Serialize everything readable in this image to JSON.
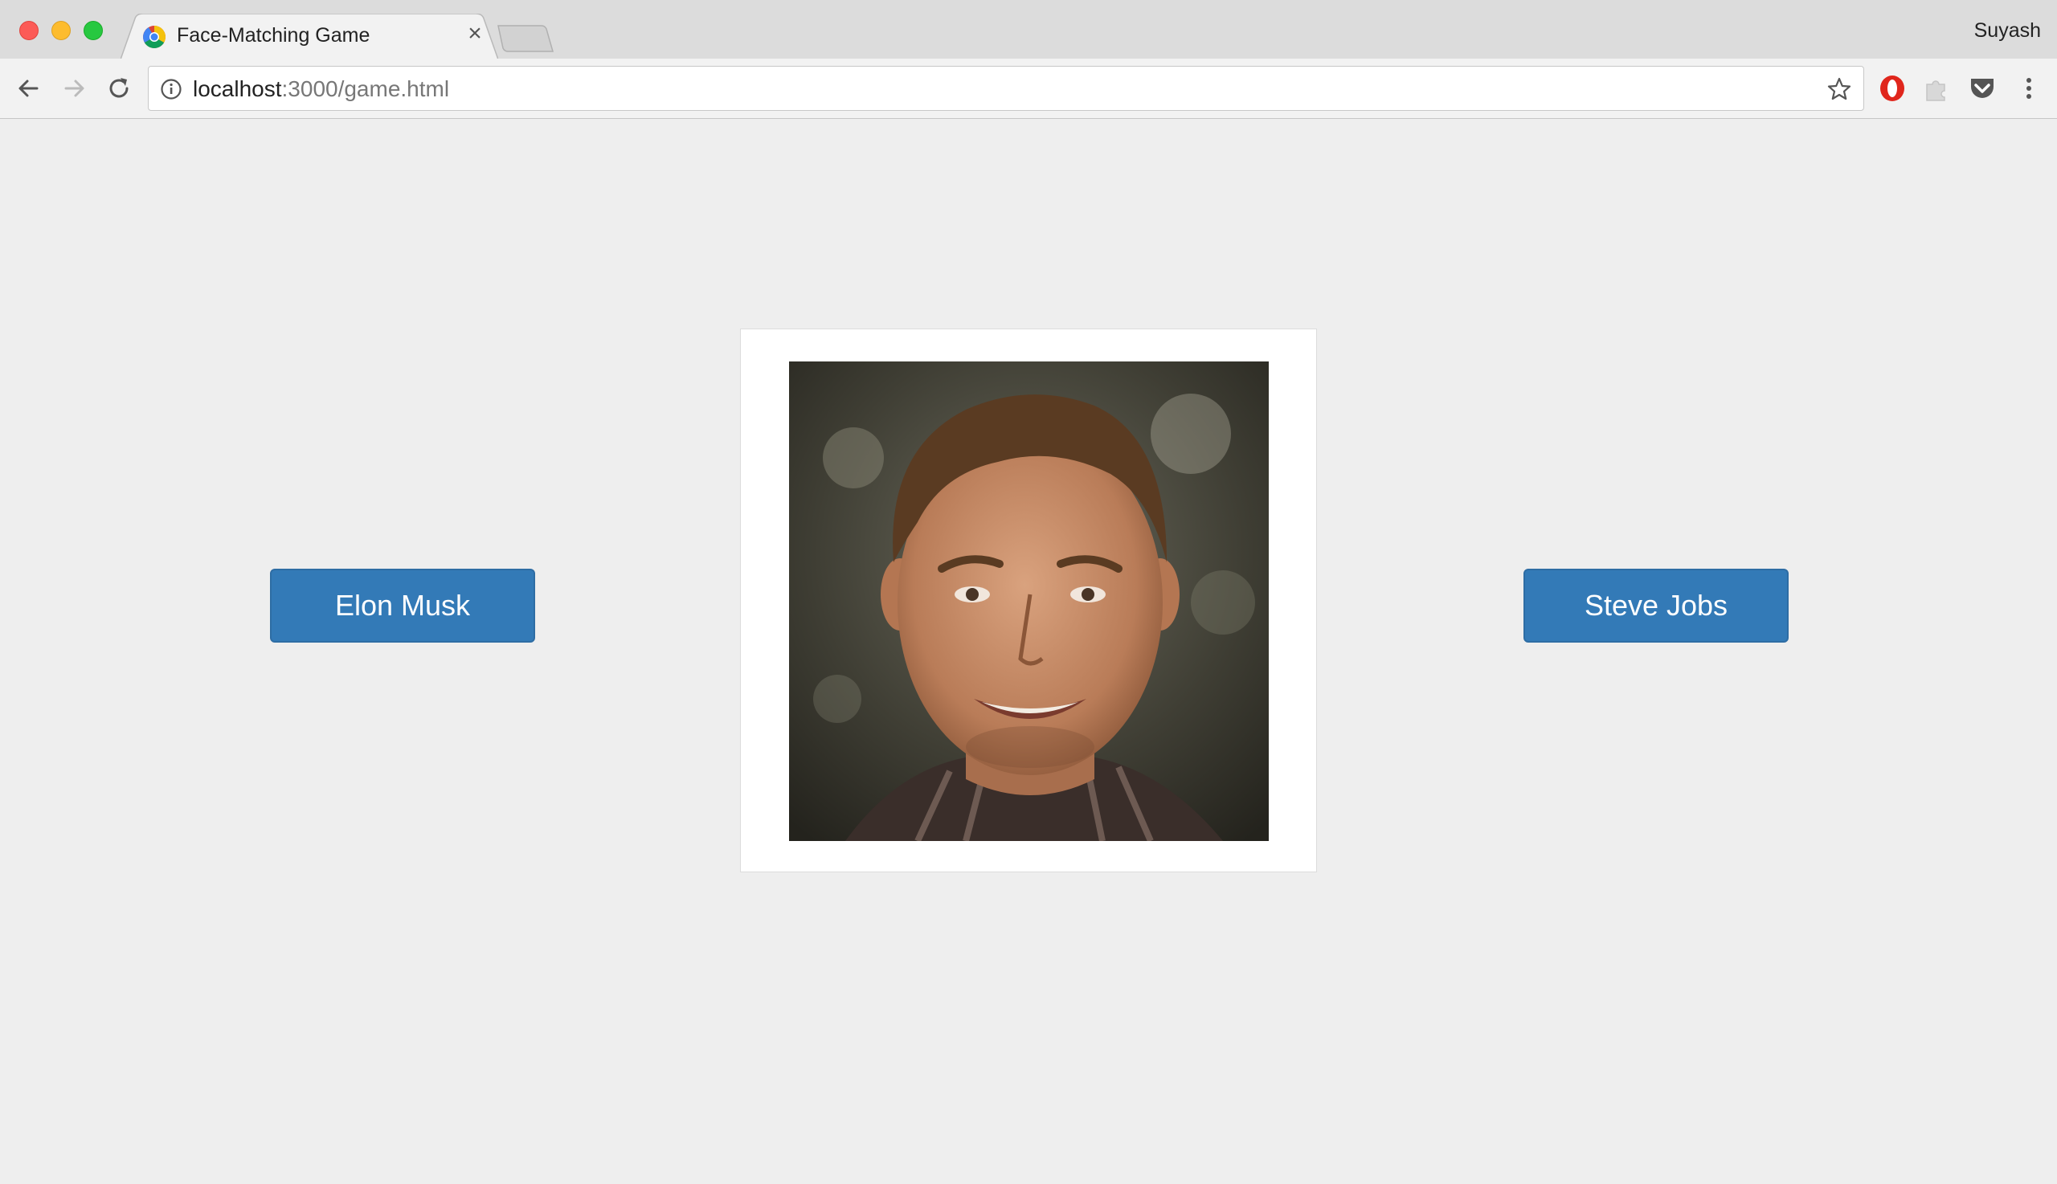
{
  "browser": {
    "tab": {
      "title": "Face-Matching Game",
      "close_glyph": "×"
    },
    "profile_name": "Suyash",
    "url": {
      "host": "localhost",
      "path": ":3000/game.html"
    },
    "icons": [
      "back-icon",
      "forward-icon",
      "reload-icon",
      "info-icon",
      "star-icon",
      "opera-extension-icon",
      "puzzle-extension-icon",
      "pocket-extension-icon",
      "menu-icon"
    ]
  },
  "game": {
    "choices": [
      {
        "label": "Elon Musk"
      },
      {
        "label": "Steve Jobs"
      }
    ],
    "photo_subject": "portrait of a smiling man with short brown hair",
    "colors": {
      "button": "#337ab7",
      "button_text": "#ffffff",
      "background": "#eeeeee",
      "card": "#ffffff"
    }
  }
}
